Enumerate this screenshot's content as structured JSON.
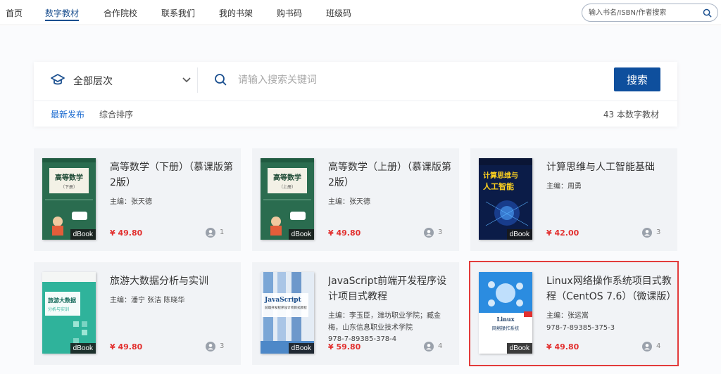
{
  "nav": {
    "items": [
      {
        "label": "首页",
        "active": false
      },
      {
        "label": "数字教材",
        "active": true
      },
      {
        "label": "合作院校",
        "active": false
      },
      {
        "label": "联系我们",
        "active": false
      },
      {
        "label": "我的书架",
        "active": false
      },
      {
        "label": "购书码",
        "active": false
      },
      {
        "label": "班级码",
        "active": false
      }
    ],
    "search_placeholder": "输入书名/ISBN/作者搜索",
    "search_icon": "search-icon"
  },
  "filter": {
    "level_icon": "graduation-cap-icon",
    "level_label": "全部层次",
    "level_chevron": "chevron-down-icon",
    "keyword_placeholder": "请输入搜索关键词",
    "search_button": "搜索",
    "sort_tabs": [
      {
        "label": "最新发布",
        "active": true
      },
      {
        "label": "综合排序",
        "active": false
      }
    ],
    "total": "43 本数字教材"
  },
  "colors": {
    "brand": "#0e4f9d",
    "price": "#e2302f",
    "selected_border": "#e23b3b",
    "card_bg": "#f1f3f6"
  },
  "books": [
    {
      "title": "高等数学（下册）（慕课版第2版）",
      "editor": "主编：张天德",
      "isbn": "",
      "price": "¥ 49.80",
      "readers": "1",
      "badge": "dBook",
      "cover": {
        "style": "math",
        "text": "高等数学",
        "sub": "（下册）",
        "bg": "#2a6c4f"
      }
    },
    {
      "title": "高等数学（上册）（慕课版第2版）",
      "editor": "主编：张天德",
      "isbn": "",
      "price": "¥ 49.80",
      "readers": "3",
      "badge": "dBook",
      "cover": {
        "style": "math",
        "text": "高等数学",
        "sub": "（上册）",
        "bg": "#2a6c4f"
      }
    },
    {
      "title": "计算思维与人工智能基础",
      "editor": "主编：周勇",
      "isbn": "",
      "price": "¥ 42.00",
      "readers": "3",
      "badge": "dBook",
      "cover": {
        "style": "ai",
        "text": "计算思维与",
        "sub": "人工智能",
        "bg": "#0b1c48"
      }
    },
    {
      "title": "旅游大数据分析与实训",
      "editor": "主编：潘宁 张洁 陈晓华",
      "isbn": "",
      "price": "¥ 49.80",
      "readers": "3",
      "badge": "dBook",
      "cover": {
        "style": "travel",
        "text": "旅游大数据",
        "sub": "分析与实训",
        "bg": "#2fb39b"
      }
    },
    {
      "title": "JavaScript前端开发程序设计项目式教程",
      "editor": "主编：李玉臣，潍坊职业学院；臧金梅，山东信息职业技术学院",
      "isbn": "978-7-89385-378-4",
      "price": "¥ 59.80",
      "readers": "4",
      "badge": "dBook",
      "cover": {
        "style": "js",
        "text": "JavaScript",
        "sub": "前端开发程序设计项目式教程",
        "bg": "#4d88c8"
      }
    },
    {
      "title": "Linux网络操作系统项目式教程（CentOS 7.6）（微课版）",
      "editor": "主编：张运嵩",
      "isbn": "978-7-89385-375-3",
      "price": "¥ 49.80",
      "readers": "4",
      "badge": "dBook",
      "cover": {
        "style": "linux",
        "text": "Linux",
        "sub": "网络操作系统",
        "bg": "#ffffff"
      }
    }
  ]
}
